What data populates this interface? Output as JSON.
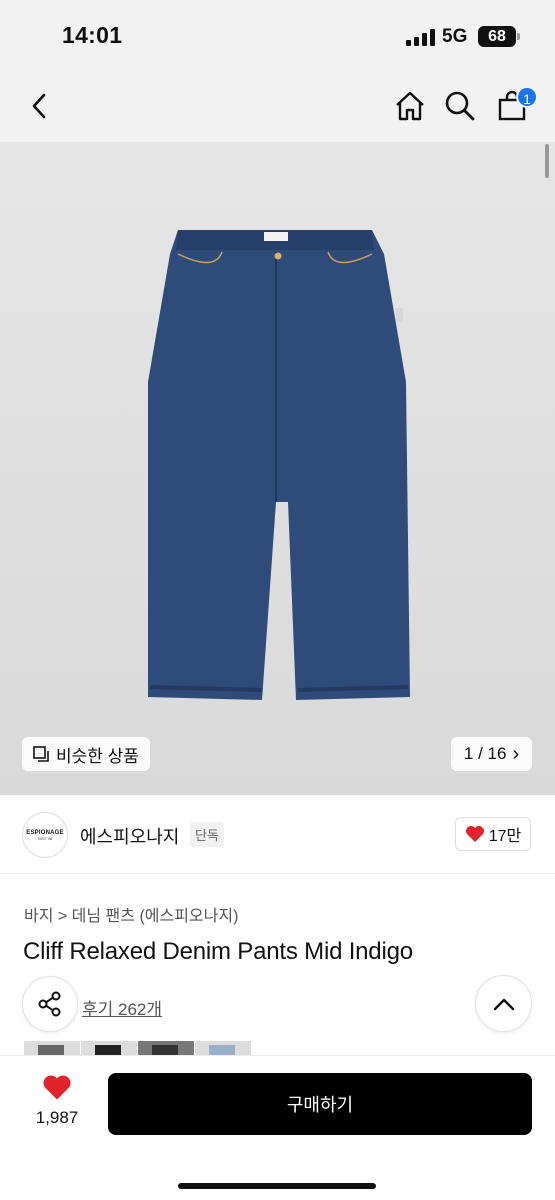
{
  "status": {
    "time": "14:01",
    "network": "5G",
    "battery": "68"
  },
  "nav": {
    "cart_count": "1"
  },
  "hero": {
    "similar_label": "비슷한 상품",
    "pager": "1 / 16",
    "pager_arrow": "›"
  },
  "brand": {
    "name": "에스피오나지",
    "badge": "단독",
    "likes": "17만",
    "logo_main": "ESPIONAGE",
    "logo_sub": "NIST'96"
  },
  "product": {
    "breadcrumb": "바지 > 데님 팬츠 (에스피오나지)",
    "title": "Cliff Relaxed Denim Pants Mid Indigo",
    "reviews": "후기 262개"
  },
  "thumbnails": [
    "gray",
    "black",
    "dark",
    "light"
  ],
  "bottom": {
    "wish_count": "1,987",
    "buy_label": "구매하기"
  },
  "colors": {
    "accent_blue": "#1a73e8",
    "like_red": "#e0242b",
    "buy_black": "#000000",
    "denim": "#2f4b7a"
  },
  "icons": [
    "back-icon",
    "home-icon",
    "search-icon",
    "cart-icon",
    "similar-icon",
    "heart-icon",
    "share-icon",
    "chevron-up-icon"
  ]
}
